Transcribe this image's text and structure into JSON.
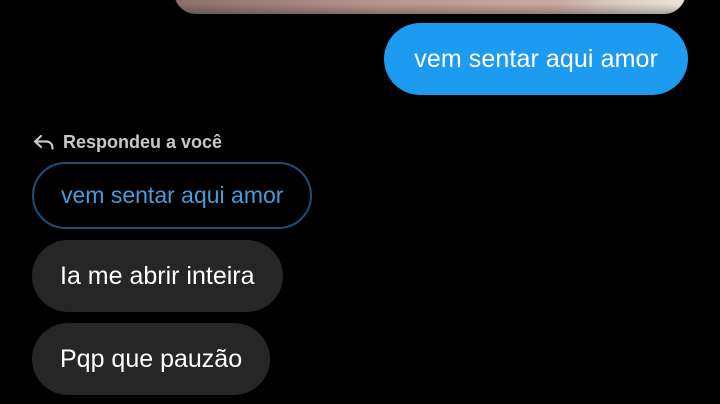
{
  "conversation": {
    "sent_messages": [
      {
        "text": "vem sentar aqui amor"
      }
    ],
    "reply": {
      "label": "Respondeu a você",
      "quoted_text": "vem sentar aqui amor"
    },
    "received_messages": [
      {
        "text": "Ia me abrir inteira"
      },
      {
        "text": "Pqp que pauzão"
      }
    ]
  },
  "colors": {
    "background": "#000000",
    "sent_bubble": "#1d9bf0",
    "received_bubble": "#262626",
    "quoted_border": "#1e4f78",
    "quoted_text": "#4a9bdb",
    "reply_label": "#c8c8c8"
  },
  "icons": {
    "reply": "reply-arrow-icon"
  }
}
